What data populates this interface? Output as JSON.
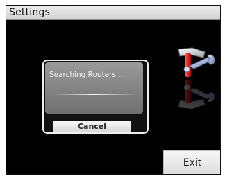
{
  "window": {
    "title": "Settings"
  },
  "dialog": {
    "message": "Searching Routers...",
    "cancel_label": "Cancel"
  },
  "footer": {
    "exit_label": "Exit"
  },
  "icons": {
    "settings_tools": "tools-icon",
    "progress": "progress-indicator"
  },
  "colors": {
    "screen_background": "#000000",
    "title_bar": "#dcdcdc",
    "dialog_body": "#858585",
    "button_face": "#eeeeee"
  }
}
